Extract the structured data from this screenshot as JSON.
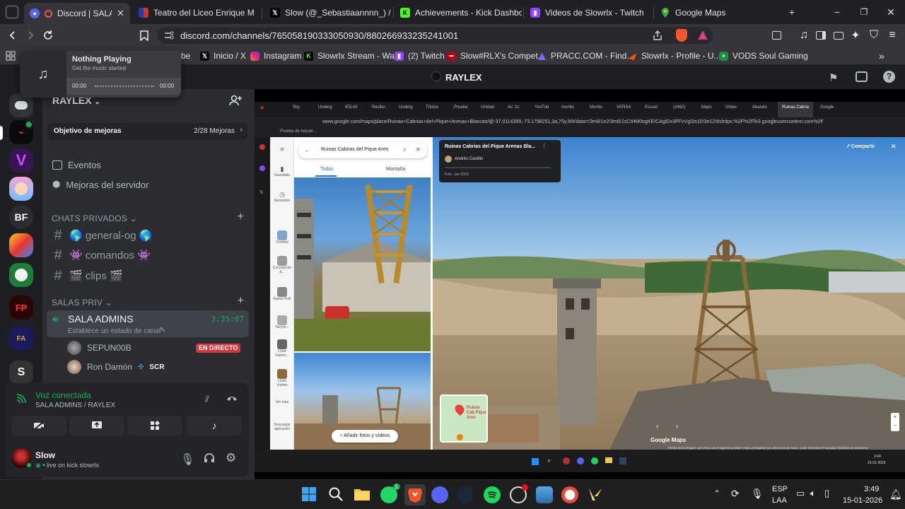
{
  "browser": {
    "tabs": [
      {
        "title": "Discord | SALA ADMINS",
        "favicon": "discord-icon",
        "color": "#5865f2",
        "active": true
      },
      {
        "title": "Teatro del Liceo Enrique Molina",
        "favicon": "flag-icon",
        "color": "#d93025"
      },
      {
        "title": "Slow (@_Sebastiaannnn_) / X",
        "favicon": "x-icon",
        "color": "#000000"
      },
      {
        "title": "Achievements - Kick Dashboard",
        "favicon": "kick-icon",
        "color": "#53fc18"
      },
      {
        "title": "Videos de Slowrlx - Twitch",
        "favicon": "twitch-icon",
        "color": "#9146ff"
      },
      {
        "title": "Google Maps",
        "favicon": "maps-icon",
        "color": "#34a853"
      }
    ],
    "new_tab": "+",
    "window_controls": {
      "minimize": "−",
      "maximize": "❐",
      "close": "✕"
    },
    "url": "discord.com/channels/765058190333050930/880266933235241001",
    "bookmarks": [
      {
        "label": "be",
        "favicon": "youtube-icon",
        "color": "#ff0000"
      },
      {
        "label": "Inicio / X",
        "favicon": "x-icon",
        "color": "#000000"
      },
      {
        "label": "Instagram",
        "favicon": "instagram-icon",
        "color": "#e1306c"
      },
      {
        "label": "Slowrlx Stream - Wa...",
        "favicon": "kick-icon",
        "color": "#53fc18"
      },
      {
        "label": "(2) Twitch",
        "favicon": "twitch-icon",
        "color": "#9146ff"
      },
      {
        "label": "Slow#RLX's Compet...",
        "favicon": "faceit-icon",
        "color": "#ff5500"
      },
      {
        "label": "PRACC.COM - Find...",
        "favicon": "pracc-icon",
        "color": "#7b68ee"
      },
      {
        "label": "Slowrlx - Profile - U...",
        "favicon": "faceit-icon",
        "color": "#ff5500"
      },
      {
        "label": "VODS Soul Gaming",
        "favicon": "plus-icon",
        "color": "#34a853"
      }
    ]
  },
  "music": {
    "title": "Nothing Playing",
    "subtitle": "Get the music started",
    "time_start": "00:00",
    "time_end": "00:00"
  },
  "discord": {
    "title": "RAYLEX",
    "server_name": "RAYLEX",
    "boost_goal": {
      "label": "Objetivo de mejoras",
      "value": "2/28 Mejoras"
    },
    "menu_items": [
      "Eventos",
      "Mejoras del servidor"
    ],
    "categories": [
      {
        "name": "CHATS PRIVADOS",
        "channels": [
          "🌎 general-og 🌎",
          "👾 comandos 👾",
          "🎬 clips 🎬"
        ]
      },
      {
        "name": "SALAS PRIV"
      }
    ],
    "voice_channel": {
      "name": "SALA ADMINS",
      "timer": "3:35:07",
      "status": "Establece un estado de canal",
      "users": [
        {
          "name": "SEPUN00B",
          "badge": "EN DIRECTO"
        },
        {
          "name": "Ron Damón",
          "tag": "SCR"
        }
      ]
    },
    "voice_panel": {
      "title": "Voz conectada",
      "subtitle": "SALA ADMINS / RAYLEX"
    },
    "user": {
      "name": "Slow",
      "status": "live on kick slowrlx"
    },
    "servers": [
      "BF"
    ]
  },
  "stream": {
    "inner_url": "www.google.com/maps/place/Ruinas+Cabrias+del+Pique+Arenas+Blancas/@-37.0114399,-73.1798251,3a,75y,90t/data=!3m8!1e2!3m6!1sCIHM0ogKEICAgIDx3PFvVg!2e10!3e12!6shttps:%2F%2Flh3.googleusercontent.com%2F",
    "inner_bookmark": "Prueba de mecan...",
    "inner_tabs": [
      "Sky",
      "Underg",
      "IED-M",
      "Recibo",
      "Underg",
      "Títulos",
      "Prueba",
      "Unidad",
      "Av. 21",
      "YouTub",
      "monito",
      "Monito",
      "VERSA",
      "Escuel",
      "(2482)",
      "Maps",
      "Urbex",
      "Abando",
      "Ruinas Cabria",
      "Google"
    ],
    "search_text": "Ruinas Cabrias del Pique Aren",
    "filter_tabs": [
      "Todas",
      "Montaña"
    ],
    "add_photos": "Añadir fotos y vídeos",
    "side_items": [
      "Guardado",
      "Recientes",
      "Coronel",
      "Concepción &...",
      "Nueva York",
      "Tarryto...",
      "Louis Vuitton...",
      "Louis Vuitton",
      "Ver más",
      "Descargar aplicación"
    ],
    "place_title": "Ruinas Cabrias del Pique Arenas Bla...",
    "place_author": "Andrés Castillo",
    "place_date": "Foto - jun 2023",
    "share": "Compartir",
    "mini_map_label": "Ruinas Cab Pique Aren",
    "google_maps": "Google Maps",
    "footer": "Fecha de la imagen: jun 2023     Las imágenes pueden estar protegidas por derechos de autor.     Chile     Términos     Privacidad     Notificar un problema",
    "inner_clock": "3:49",
    "inner_date": "15-01-2026"
  },
  "taskbar": {
    "lang_top": "ESP",
    "lang_bottom": "LAA",
    "time": "3:49",
    "date": "15-01-2026"
  }
}
